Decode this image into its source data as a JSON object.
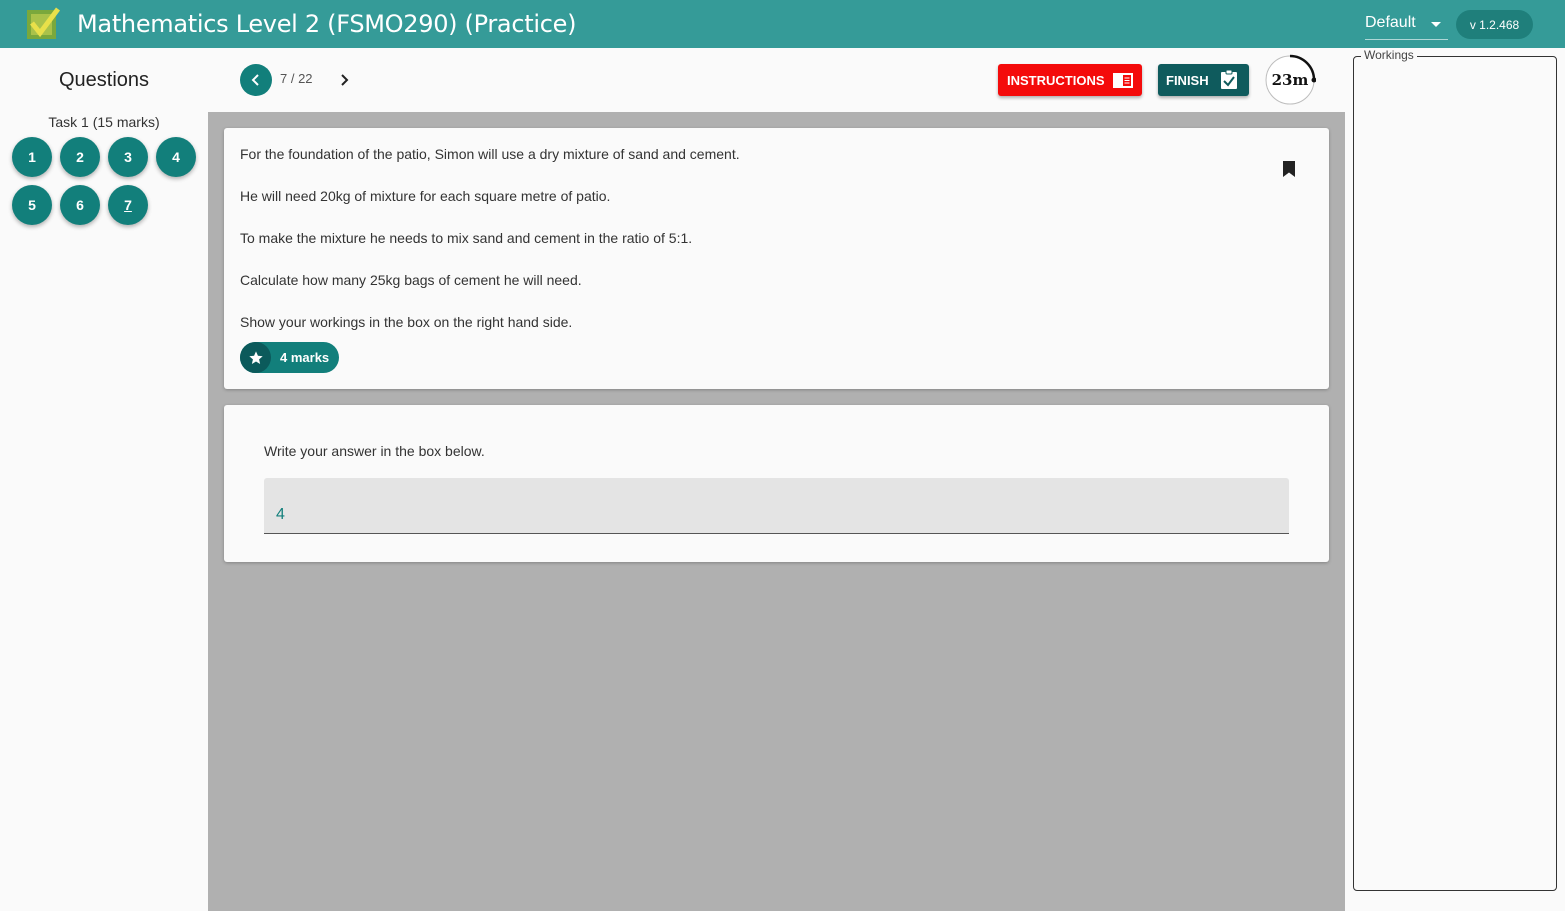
{
  "header": {
    "title": "Mathematics Level 2 (FSMO290) (Practice)",
    "theme_value": "Default",
    "version": "v 1.2.468",
    "brand_color": "#359b98"
  },
  "sidebar": {
    "title": "Questions",
    "task_label": "Task 1 (15 marks)",
    "questions": [
      {
        "label": "1"
      },
      {
        "label": "2"
      },
      {
        "label": "3"
      },
      {
        "label": "4"
      },
      {
        "label": "5"
      },
      {
        "label": "6"
      },
      {
        "label": "7",
        "current": true
      }
    ]
  },
  "nav": {
    "counter": "7 / 22",
    "instructions_label": "INSTRUCTIONS",
    "finish_label": "FINISH",
    "timer": "23m"
  },
  "question": {
    "lines": [
      "For the foundation of the patio, Simon will use a dry mixture of sand and cement.",
      "He will need 20kg of mixture for each square metre of patio.",
      "To make the mixture he needs to mix sand and cement in the ratio of 5:1.",
      "Calculate how many 25kg bags of cement he will need.",
      "Show your workings in the box on the right hand side."
    ],
    "marks_label": "4 marks"
  },
  "answer": {
    "prompt": "Write your answer in the box below.",
    "value": "4"
  },
  "workings": {
    "legend": "Workings"
  },
  "icons": {
    "logo": "checkmark-logo-icon",
    "prev": "chevron-left-icon",
    "next": "chevron-right-icon",
    "instructions": "book-open-icon",
    "finish": "clipboard-check-icon",
    "bookmark": "bookmark-icon",
    "marks": "star-icon"
  }
}
